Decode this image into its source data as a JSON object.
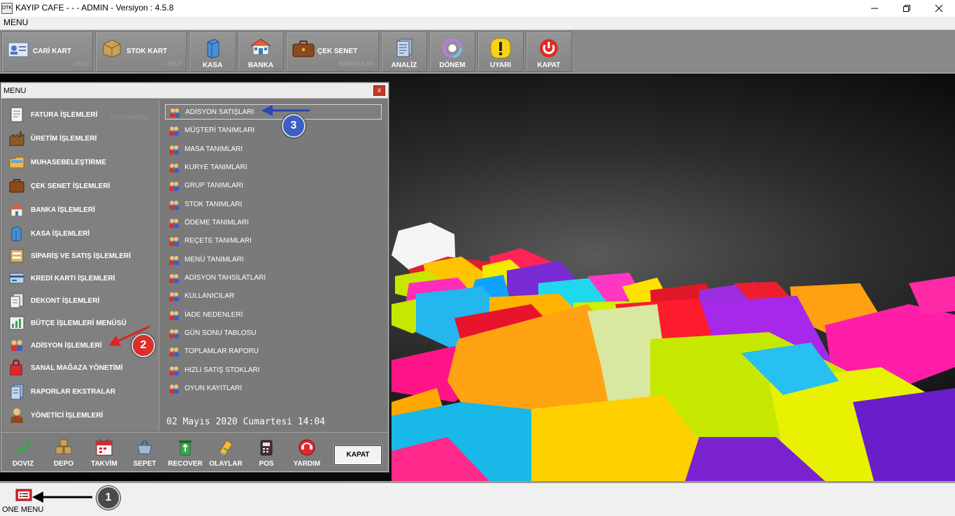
{
  "window": {
    "title": "KAYIP CAFE -  -  - ADMIN -  Versiyon : 4.5.8",
    "menubar_label": "MENU",
    "app_icon_text": "DTK"
  },
  "toolbar": {
    "items": [
      {
        "label": "CARİ KART",
        "sub": "EKLE",
        "icon": "contact-card-icon"
      },
      {
        "label": "STOK KART",
        "sub": "EKLE",
        "icon": "stock-box-icon"
      },
      {
        "label": "KASA",
        "icon": "cash-register-icon"
      },
      {
        "label": "BANKA",
        "icon": "bank-icon"
      },
      {
        "label": "ÇEK SENET",
        "sub": "BORDROLAR",
        "icon": "briefcase-icon"
      },
      {
        "label": "ANALİZ",
        "icon": "analysis-docs-icon"
      },
      {
        "label": "DÖNEM",
        "icon": "period-cycle-icon"
      },
      {
        "label": "UYARI",
        "icon": "warning-icon"
      },
      {
        "label": "KAPAT",
        "icon": "power-icon"
      }
    ]
  },
  "menu_window": {
    "title": "MENU",
    "close_glyph": "x",
    "ghost_text": "KDV RAPORU",
    "left_items": [
      {
        "label": "FATURA İŞLEMLERİ",
        "icon": "invoice-icon"
      },
      {
        "label": "ÜRETİM İŞLEMLERİ",
        "icon": "factory-icon"
      },
      {
        "label": "MUHASEBELEŞTİRME",
        "icon": "folder-icon"
      },
      {
        "label": "ÇEK SENET İŞLEMLERİ",
        "icon": "briefcase-icon"
      },
      {
        "label": "BANKA İŞLEMLERİ",
        "icon": "bank-icon"
      },
      {
        "label": "KASA İŞLEMLERİ",
        "icon": "cash-register-icon"
      },
      {
        "label": "SİPARİŞ VE SATIŞ İŞLEMLERİ",
        "icon": "order-icon"
      },
      {
        "label": "KREDİ KARTI İŞLEMLERİ",
        "icon": "credit-card-icon"
      },
      {
        "label": "DEKONT İŞLEMLERİ",
        "icon": "receipt-icon"
      },
      {
        "label": "BÜTÇE İŞLEMLERİ MENÜSÜ",
        "icon": "budget-chart-icon"
      },
      {
        "label": "ADİSYON İŞLEMLERİ",
        "icon": "people-group-icon"
      },
      {
        "label": "SANAL MAĞAZA YÖNETİMİ",
        "icon": "shopping-bag-icon"
      },
      {
        "label": "RAPORLAR EKSTRALAR",
        "icon": "reports-icon"
      },
      {
        "label": "YÖNETİCİ İŞLEMLERİ",
        "icon": "admin-user-icon"
      }
    ],
    "right_items": [
      {
        "label": "ADİSYON SATIŞLARI",
        "selected": true
      },
      {
        "label": "MÜŞTERİ TANIMLARI"
      },
      {
        "label": "MASA TANIMLARI"
      },
      {
        "label": "KURYE TANIMLARI"
      },
      {
        "label": "GRUP TANIMLARI"
      },
      {
        "label": "STOK TANIMLARI"
      },
      {
        "label": "ÖDEME TANIMLARI"
      },
      {
        "label": "REÇETE TANIMLARI"
      },
      {
        "label": "MENÜ TANIMLARI"
      },
      {
        "label": "ADİSYON TAHSİLATLARI"
      },
      {
        "label": "KULLANICILAR"
      },
      {
        "label": "İADE NEDENLERİ"
      },
      {
        "label": "GÜN SONU TABLOSU"
      },
      {
        "label": "TOPLAMLAR RAPORU"
      },
      {
        "label": "HIZLI SATIŞ STOKLARI"
      },
      {
        "label": "OYUN KAYITLARI"
      }
    ],
    "datetime": "02 Mayıs 2020 Cumartesi 14:04",
    "bottom_buttons": [
      {
        "label": "DOVIZ",
        "icon": "currency-chart-icon"
      },
      {
        "label": "DEPO",
        "icon": "warehouse-boxes-icon"
      },
      {
        "label": "TAKVİM",
        "icon": "calendar-icon"
      },
      {
        "label": "SEPET",
        "icon": "basket-icon"
      },
      {
        "label": "RECOVER",
        "icon": "recycle-bin-icon"
      },
      {
        "label": "OLAYLAR",
        "icon": "events-icon"
      },
      {
        "label": "POS",
        "icon": "pos-terminal-icon"
      },
      {
        "label": "YARDIM",
        "icon": "support-24-7-icon"
      }
    ],
    "kapat_label": "KAPAT"
  },
  "bottom_bar": {
    "one_menu_label": "ONE MENU"
  },
  "annotations": [
    {
      "number": "1",
      "color": "#4a4a4a"
    },
    {
      "number": "2",
      "color": "#d9302b"
    },
    {
      "number": "3",
      "color": "#3b5fc4"
    }
  ],
  "colors": {
    "toolbar_bg": "#8a8a8a",
    "menu_panel_bg": "#7b7b7b",
    "close_red": "#c0392b"
  }
}
